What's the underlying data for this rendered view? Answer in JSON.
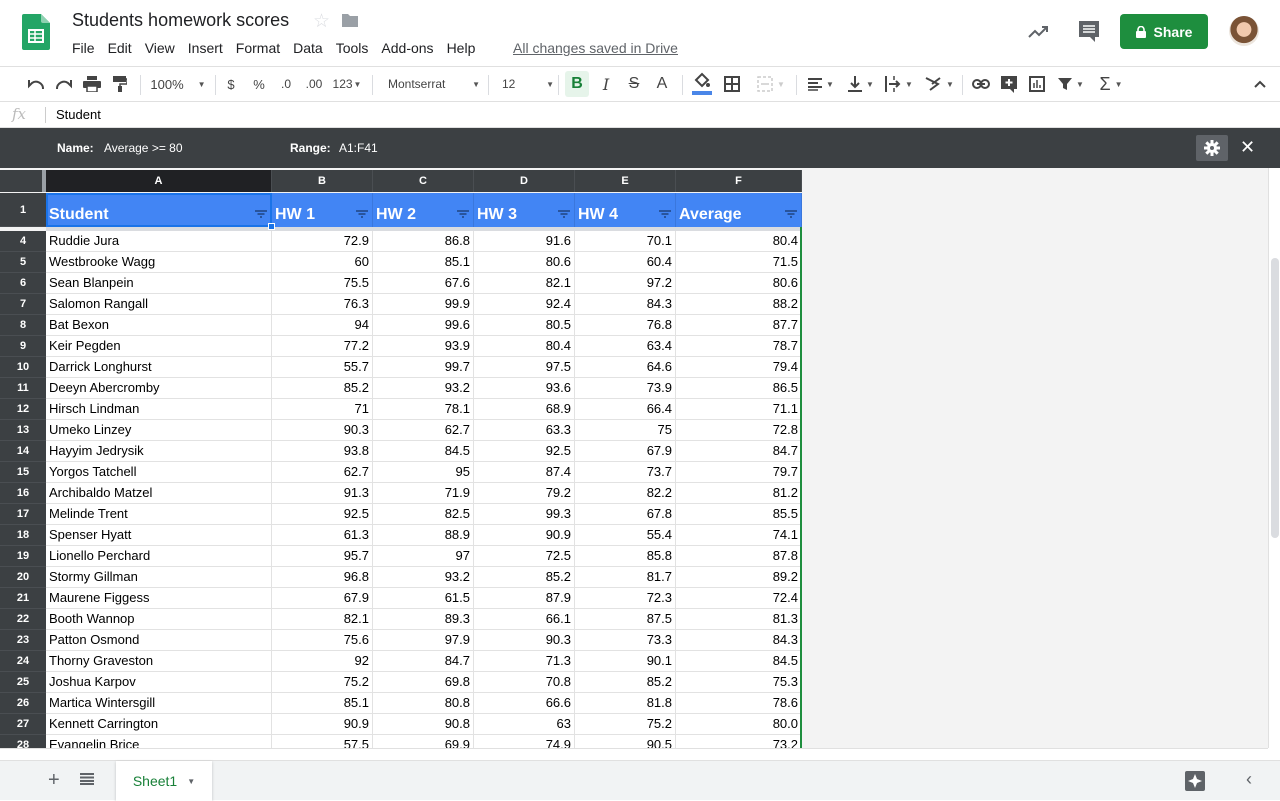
{
  "app": {
    "doc_title": "Students homework scores",
    "saved_status": "All changes saved in Drive",
    "share_label": "Share",
    "menu": [
      "File",
      "Edit",
      "View",
      "Insert",
      "Format",
      "Data",
      "Tools",
      "Add-ons",
      "Help"
    ]
  },
  "toolbar": {
    "zoom": "100%",
    "currency": "$",
    "percent": "%",
    "dec_decrease": ".0",
    "dec_increase": ".00",
    "more_formats": "123",
    "font": "Montserrat",
    "font_size": "12",
    "bold": "B",
    "italic": "I",
    "strike": "S",
    "text_color": "A",
    "fill_color_indicator": "#4a86e8",
    "icons": [
      "undo-icon",
      "redo-icon",
      "print-icon",
      "paint-format-icon",
      "fill-color-icon",
      "borders-icon",
      "merge-icon",
      "h-align-icon",
      "v-align-icon",
      "text-wrap-icon",
      "text-rotate-icon",
      "link-icon",
      "comment-add-icon",
      "chart-icon",
      "filter-icon",
      "functions-icon",
      "collapse-icon"
    ]
  },
  "formula_bar": {
    "fx": "fx",
    "value": "Student"
  },
  "filter_view": {
    "name_label": "Name:",
    "name_value": "Average >= 80",
    "range_label": "Range:",
    "range_value": "A1:F41",
    "close": "✕"
  },
  "grid": {
    "column_letters": [
      "A",
      "B",
      "C",
      "D",
      "E",
      "F"
    ],
    "header_row_number": "1",
    "headers": [
      "Student",
      "HW 1",
      "HW 2",
      "HW 3",
      "HW 4",
      "Average"
    ],
    "rows": [
      {
        "n": "4",
        "cells": [
          "Ruddie Jura",
          "72.9",
          "86.8",
          "91.6",
          "70.1",
          "80.4"
        ]
      },
      {
        "n": "5",
        "cells": [
          "Westbrooke Wagg",
          "60",
          "85.1",
          "80.6",
          "60.4",
          "71.5"
        ]
      },
      {
        "n": "6",
        "cells": [
          "Sean Blanpein",
          "75.5",
          "67.6",
          "82.1",
          "97.2",
          "80.6"
        ]
      },
      {
        "n": "7",
        "cells": [
          "Salomon Rangall",
          "76.3",
          "99.9",
          "92.4",
          "84.3",
          "88.2"
        ]
      },
      {
        "n": "8",
        "cells": [
          "Bat Bexon",
          "94",
          "99.6",
          "80.5",
          "76.8",
          "87.7"
        ]
      },
      {
        "n": "9",
        "cells": [
          "Keir Pegden",
          "77.2",
          "93.9",
          "80.4",
          "63.4",
          "78.7"
        ]
      },
      {
        "n": "10",
        "cells": [
          "Darrick Longhurst",
          "55.7",
          "99.7",
          "97.5",
          "64.6",
          "79.4"
        ]
      },
      {
        "n": "11",
        "cells": [
          "Deeyn Abercromby",
          "85.2",
          "93.2",
          "93.6",
          "73.9",
          "86.5"
        ]
      },
      {
        "n": "12",
        "cells": [
          "Hirsch Lindman",
          "71",
          "78.1",
          "68.9",
          "66.4",
          "71.1"
        ]
      },
      {
        "n": "13",
        "cells": [
          "Umeko Linzey",
          "90.3",
          "62.7",
          "63.3",
          "75",
          "72.8"
        ]
      },
      {
        "n": "14",
        "cells": [
          "Hayyim Jedrysik",
          "93.8",
          "84.5",
          "92.5",
          "67.9",
          "84.7"
        ]
      },
      {
        "n": "15",
        "cells": [
          "Yorgos Tatchell",
          "62.7",
          "95",
          "87.4",
          "73.7",
          "79.7"
        ]
      },
      {
        "n": "16",
        "cells": [
          "Archibaldo Matzel",
          "91.3",
          "71.9",
          "79.2",
          "82.2",
          "81.2"
        ]
      },
      {
        "n": "17",
        "cells": [
          "Melinde Trent",
          "92.5",
          "82.5",
          "99.3",
          "67.8",
          "85.5"
        ]
      },
      {
        "n": "18",
        "cells": [
          "Spenser Hyatt",
          "61.3",
          "88.9",
          "90.9",
          "55.4",
          "74.1"
        ]
      },
      {
        "n": "19",
        "cells": [
          "Lionello Perchard",
          "95.7",
          "97",
          "72.5",
          "85.8",
          "87.8"
        ]
      },
      {
        "n": "20",
        "cells": [
          "Stormy Gillman",
          "96.8",
          "93.2",
          "85.2",
          "81.7",
          "89.2"
        ]
      },
      {
        "n": "21",
        "cells": [
          "Maurene Figgess",
          "67.9",
          "61.5",
          "87.9",
          "72.3",
          "72.4"
        ]
      },
      {
        "n": "22",
        "cells": [
          "Booth Wannop",
          "82.1",
          "89.3",
          "66.1",
          "87.5",
          "81.3"
        ]
      },
      {
        "n": "23",
        "cells": [
          "Patton Osmond",
          "75.6",
          "97.9",
          "90.3",
          "73.3",
          "84.3"
        ]
      },
      {
        "n": "24",
        "cells": [
          "Thorny Graveston",
          "92",
          "84.7",
          "71.3",
          "90.1",
          "84.5"
        ]
      },
      {
        "n": "25",
        "cells": [
          "Joshua Karpov",
          "75.2",
          "69.8",
          "70.8",
          "85.2",
          "75.3"
        ]
      },
      {
        "n": "26",
        "cells": [
          "Martica Wintersgill",
          "85.1",
          "80.8",
          "66.6",
          "81.8",
          "78.6"
        ]
      },
      {
        "n": "27",
        "cells": [
          "Kennett Carrington",
          "90.9",
          "90.8",
          "63",
          "75.2",
          "80.0"
        ]
      },
      {
        "n": "28",
        "cells": [
          "Evangelin Brice",
          "57.5",
          "69.9",
          "74.9",
          "90.5",
          "73.2"
        ]
      }
    ]
  },
  "sheets": {
    "add": "+",
    "tabs": [
      {
        "label": "Sheet1",
        "active": true
      }
    ]
  },
  "colors": {
    "header_fill": "#4285f4",
    "share_green": "#1e8e3e",
    "filter_bar": "#3c4043",
    "sheet_tab_text": "#188038"
  }
}
